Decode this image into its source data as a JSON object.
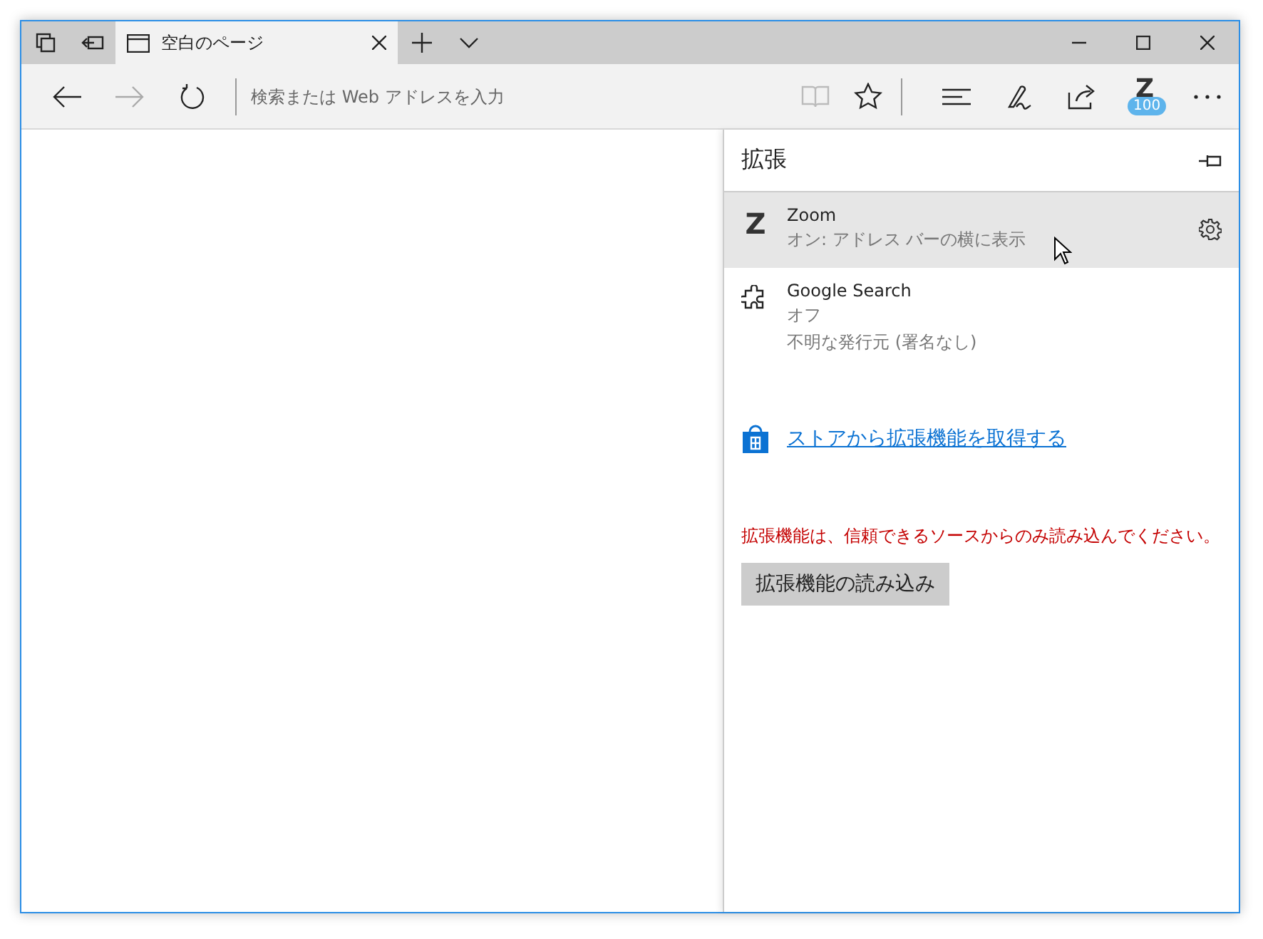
{
  "tabs": [
    {
      "title": "空白のページ",
      "selected": true
    }
  ],
  "address_bar": {
    "placeholder": "検索または Web アドレスを入力"
  },
  "toolbar": {
    "reading_view_disabled": true,
    "extension_button": {
      "letter": "Z",
      "badge": "100"
    }
  },
  "extensions_panel": {
    "title": "拡張",
    "items": [
      {
        "kind": "letter",
        "icon_text": "Z",
        "name": "Zoom",
        "lines": [
          "オン: アドレス バーの横に表示"
        ],
        "hovered": true
      },
      {
        "kind": "puzzle",
        "name": "Google Search",
        "lines": [
          "オフ",
          "不明な発行元 (署名なし)"
        ],
        "hovered": false
      }
    ],
    "store_link": "ストアから拡張機能を取得する",
    "warning": "拡張機能は、信頼できるソースからのみ読み込んでください。",
    "load_button": "拡張機能の読み込み"
  }
}
